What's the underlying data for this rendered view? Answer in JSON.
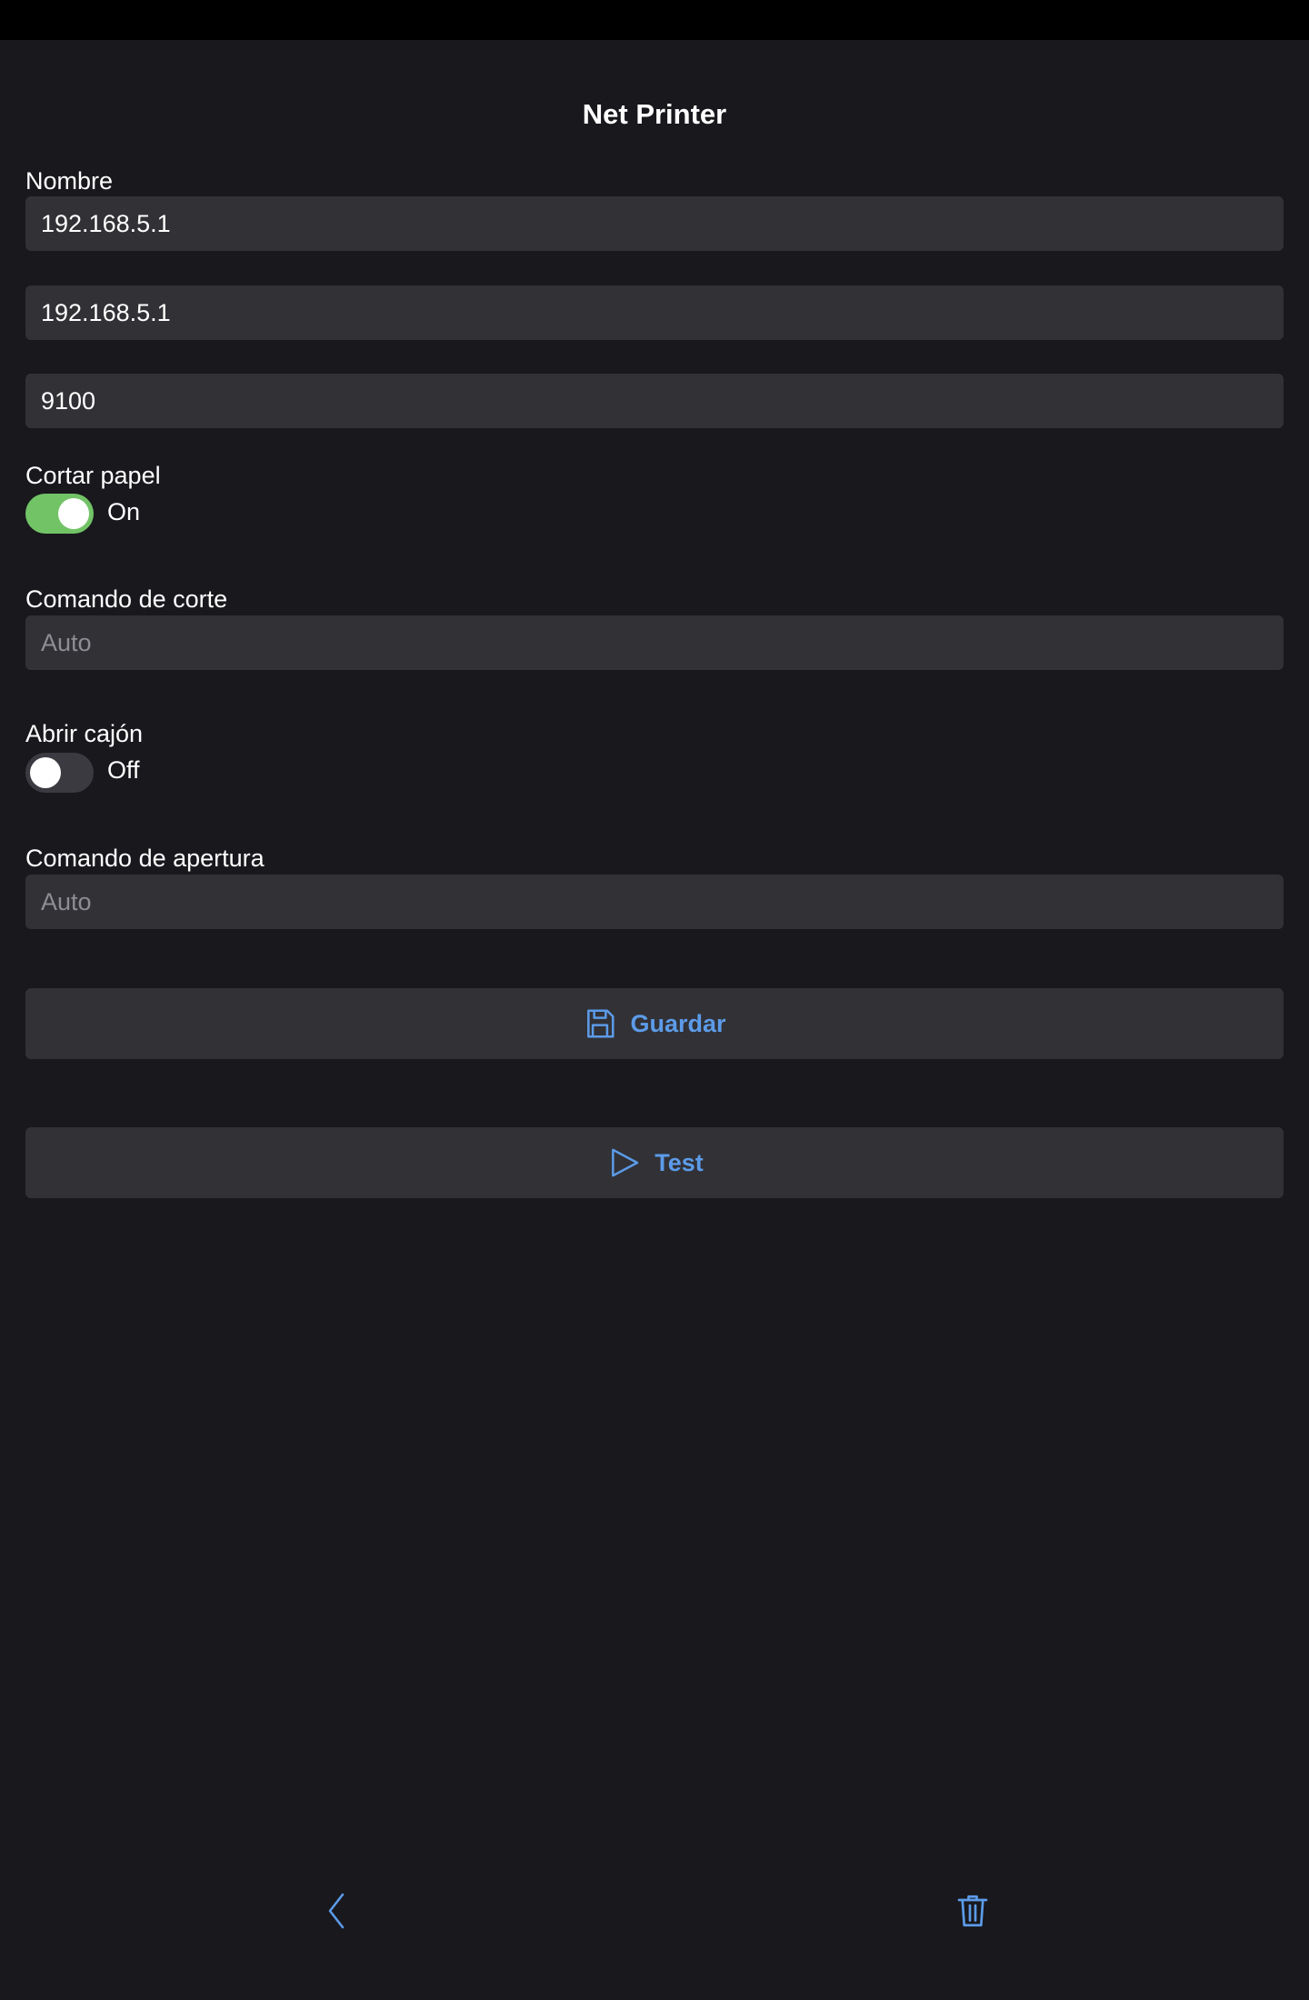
{
  "header": {
    "title": "Net Printer"
  },
  "form": {
    "name_label": "Nombre",
    "name_value": "192.168.5.1",
    "address_value": "192.168.5.1",
    "port_value": "9100",
    "cut_paper_label": "Cortar papel",
    "cut_paper_state": "On",
    "cut_paper_enabled": true,
    "cut_command_label": "Comando de corte",
    "cut_command_placeholder": "Auto",
    "open_drawer_label": "Abrir cajón",
    "open_drawer_state": "Off",
    "open_drawer_enabled": false,
    "open_command_label": "Comando de apertura",
    "open_command_placeholder": "Auto"
  },
  "actions": {
    "save_label": "Guardar",
    "test_label": "Test"
  },
  "bottom_nav": {
    "back_icon": "chevron-left-icon",
    "delete_icon": "trash-icon"
  },
  "colors": {
    "background": "#18181d",
    "field": "#313136",
    "accent": "#5c9be8",
    "toggle_on": "#72c366",
    "toggle_off": "#3a3a40"
  }
}
